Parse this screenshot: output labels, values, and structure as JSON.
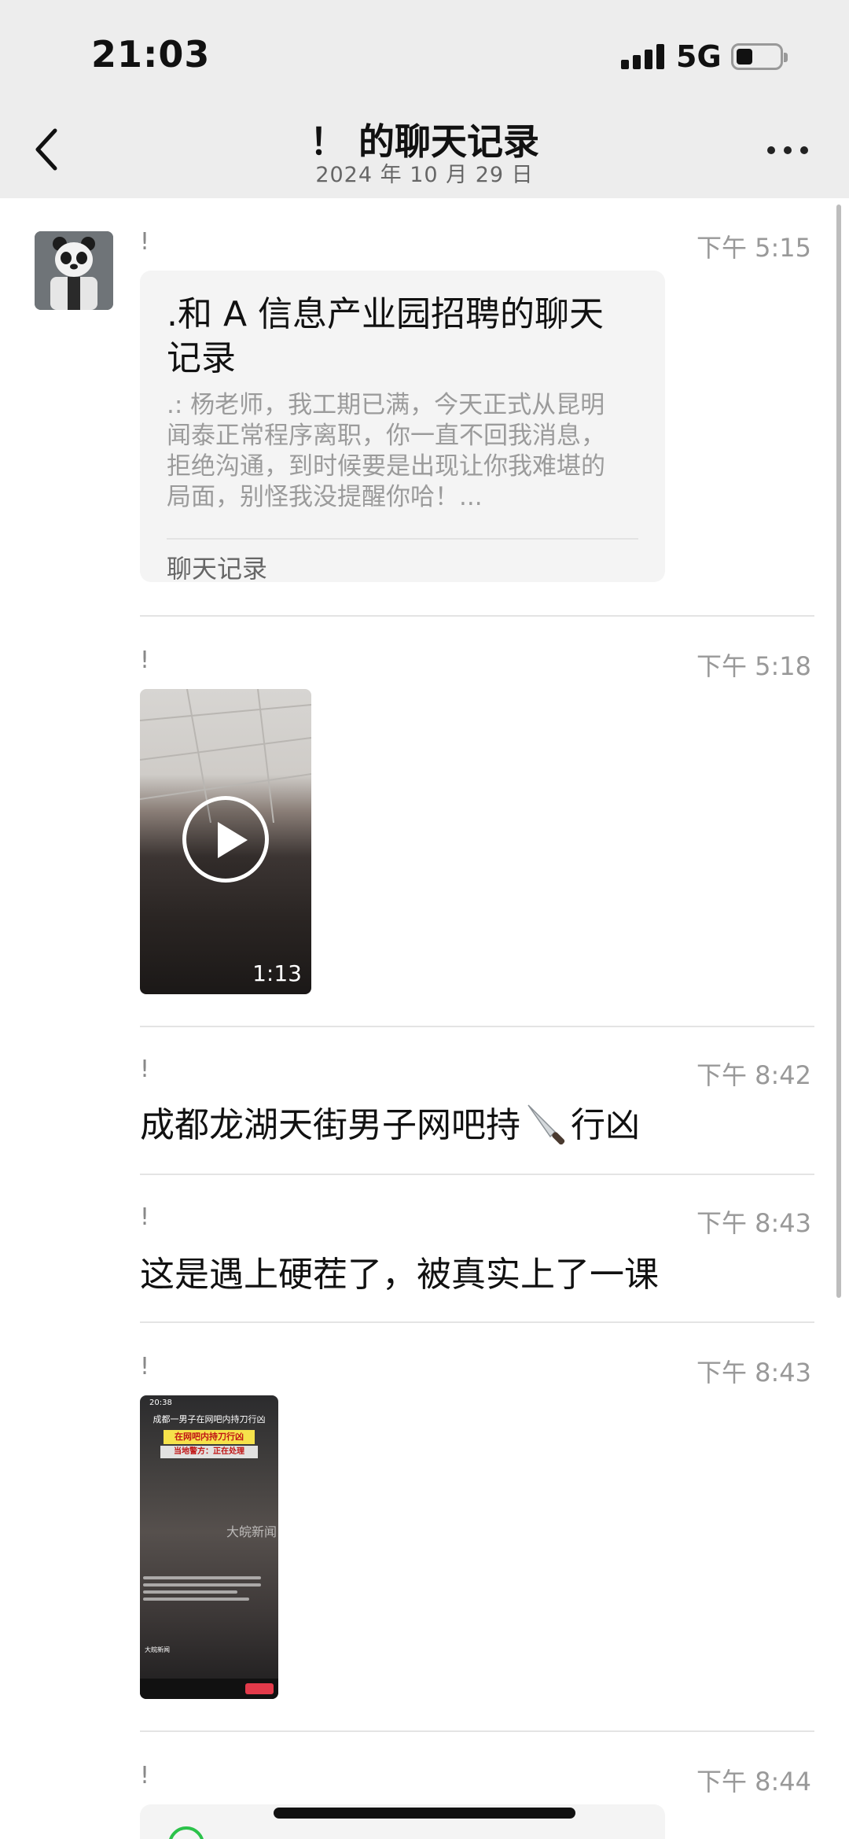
{
  "status_bar": {
    "time": "21:03",
    "network": "5G"
  },
  "nav": {
    "title": "！ 的聊天记录",
    "subtitle": "2024 年 10 月 29 日"
  },
  "messages": [
    {
      "sender": "!",
      "time": "下午 5:15",
      "card_title": ".和 A 信息产业园招聘的聊天记录",
      "card_preview": ".: 杨老师，我工期已满，今天正式从昆明闻泰正常程序离职，你一直不回我消息，拒绝沟通，到时候要是出现让你我难堪的局面，别怪我没提醒你哈！...",
      "card_footer": "聊天记录"
    },
    {
      "sender": "!",
      "time": "下午 5:18",
      "video_duration": "1:13"
    },
    {
      "sender": "!",
      "time": "下午 8:42",
      "text_before": "成都龙湖天街男子网吧持",
      "text_after": "行凶",
      "icon": "knife-icon"
    },
    {
      "sender": "!",
      "time": "下午 8:43",
      "text": "这是遇上硬茬了，被真实上了一课"
    },
    {
      "sender": "!",
      "time": "下午 8:43",
      "image": {
        "status_time": "20:38",
        "headline": "成都一男子在网吧内持刀行凶",
        "banner": "在网吧内持刀行凶",
        "sub_banner": "当地警方：正在处理",
        "watermark": "大皖新闻",
        "source": "大皖新闻"
      }
    },
    {
      "sender": "!",
      "time": "下午 8:44"
    }
  ],
  "colors": {
    "header_bg": "#ededed",
    "card_bg": "#f4f4f4",
    "accent_green": "#2bc24a"
  }
}
